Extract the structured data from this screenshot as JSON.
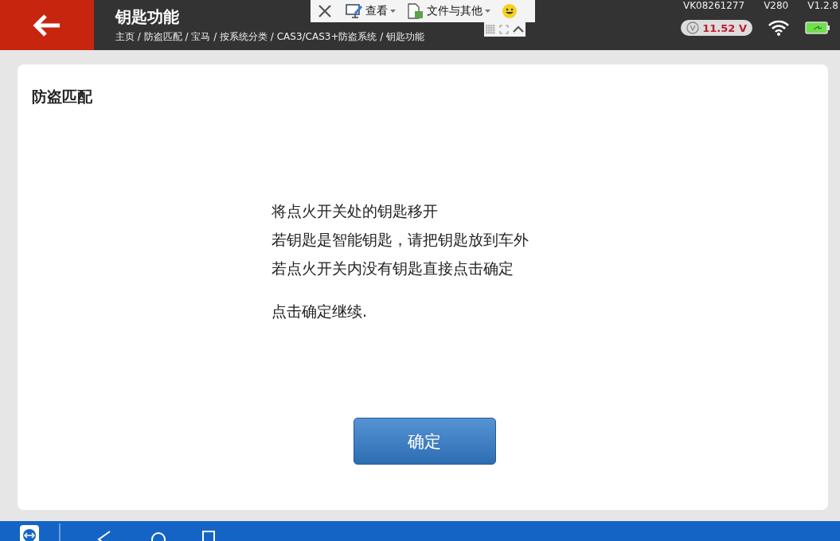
{
  "header": {
    "title": "钥匙功能",
    "breadcrumb": "主页 / 防盗匹配 / 宝马 / 按系统分类 / CAS3/CAS3+防盗系统 / 钥匙功能",
    "serial": "VK08261277",
    "version_a": "V280",
    "version_b": "V1.2.8",
    "voltage": "11.52 V"
  },
  "remote_toolbar": {
    "view_label": "查看",
    "files_label": "文件与其他"
  },
  "card": {
    "title": "防盗匹配",
    "lines": [
      "将点火开关处的钥匙移开",
      "若钥匙是智能钥匙，请把钥匙放到车外",
      "若点火开关内没有钥匙直接点击确定"
    ],
    "prompt": "点击确定继续.",
    "button": "确定"
  }
}
